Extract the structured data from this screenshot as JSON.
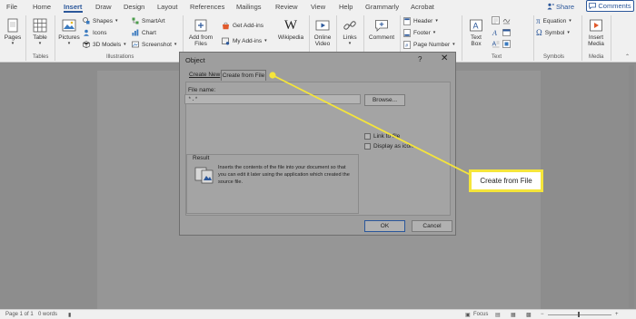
{
  "ribbon_tabs": [
    "File",
    "Home",
    "Insert",
    "Draw",
    "Design",
    "Layout",
    "References",
    "Mailings",
    "Review",
    "View",
    "Help",
    "Grammarly",
    "Acrobat"
  ],
  "share_label": "Share",
  "comments_label": "Comments",
  "ribbon": {
    "pages": "Pages",
    "table": "Table",
    "pictures": "Pictures",
    "shapes": "Shapes",
    "icons": "Icons",
    "models": "3D Models",
    "smartart": "SmartArt",
    "chart": "Chart",
    "screenshot": "Screenshot",
    "addins_from_files": "Add from Files",
    "get_addins": "Get Add-ins",
    "my_addins": "My Add-ins",
    "wikipedia": "Wikipedia",
    "online_video": "Online Video",
    "links": "Links",
    "comment": "Comment",
    "header": "Header",
    "footer": "Footer",
    "page_number": "Page Number",
    "text_box": "Text Box",
    "equation": "Equation",
    "symbol": "Symbol",
    "insert_media": "Insert Media",
    "group_tables": "Tables",
    "group_illustrations": "Illustrations",
    "group_text": "Text",
    "group_symbols": "Symbols",
    "group_media": "Media"
  },
  "dialog": {
    "title": "Object",
    "help": "?",
    "close": "✕",
    "tab_create_new": "Create New",
    "tab_create_from_file": "Create from File",
    "file_name_label": "File name:",
    "file_name_value": "*.*",
    "browse_label": "Browse...",
    "link_to_file": "Link to file",
    "display_as_icon": "Display as icon",
    "result_label": "Result",
    "result_text": "Inserts the contents of the file into your document so that you can edit it later using the application which created the source file.",
    "ok_label": "OK",
    "cancel_label": "Cancel"
  },
  "callout_label": "Create from File",
  "status": {
    "page": "Page 1 of 1",
    "words": "0 words",
    "focus": "Focus"
  },
  "colors": {
    "accent": "#2b579a",
    "callout": "#f5e53a"
  }
}
